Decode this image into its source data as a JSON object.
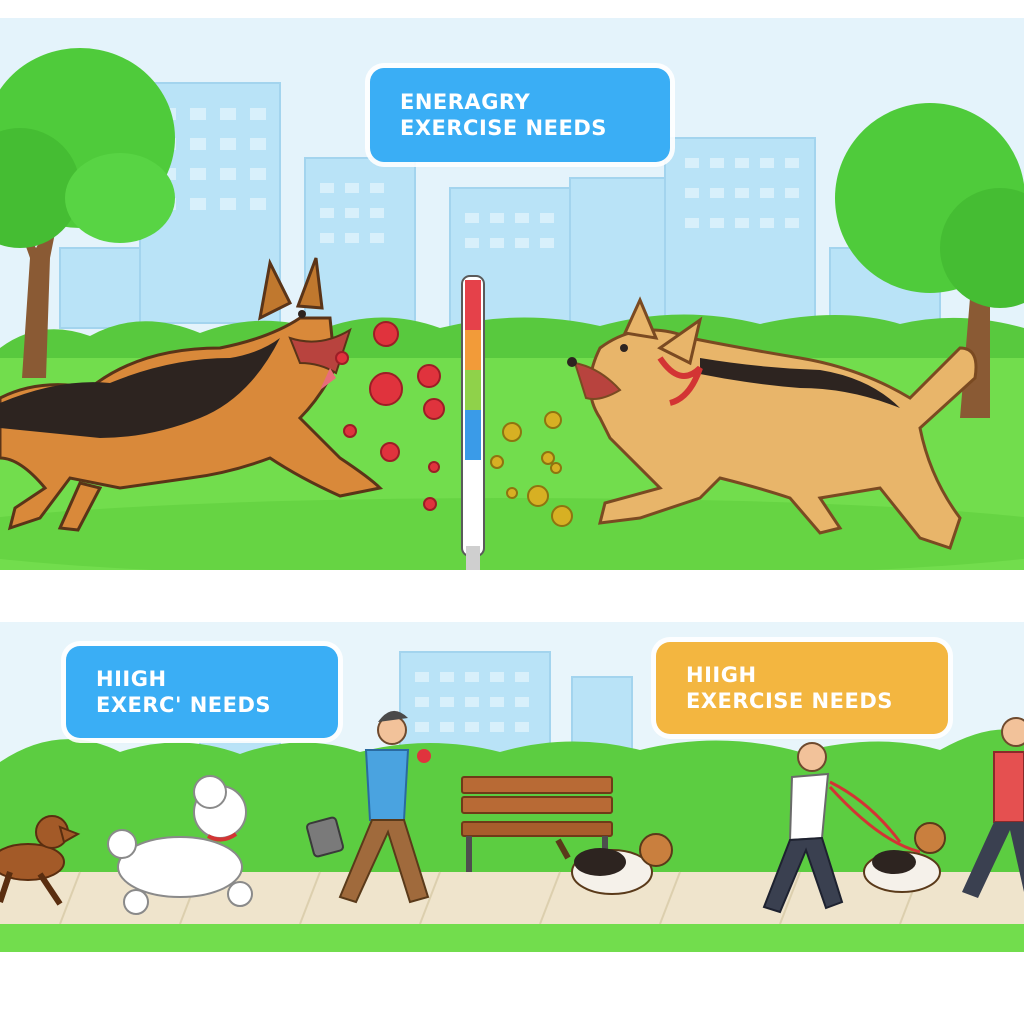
{
  "top_panel": {
    "label_line1": "ENERAGRY",
    "label_line2": "EXERCISE NEEDS",
    "label_color": "#3aaef5"
  },
  "bottom_panel": {
    "left_label_line1": "HIIGH",
    "left_label_line2": "EXERC' NEEDS",
    "left_label_color": "#3aaef5",
    "right_label_line1": "HIIGH",
    "right_label_line2": "EXERCISE NEEDS",
    "right_label_color": "#f3b640"
  },
  "colors": {
    "sky": "#e4f3fb",
    "grass": "#6fdc4a",
    "tree_foliage": "#4fcb3b",
    "building": "#b9e3f7",
    "shepherd_tan": "#d9893a",
    "shepherd_black": "#2d2420",
    "mix_dog_tan": "#e8b56a",
    "red_ball": "#e0333d",
    "yellow_ball": "#d7b023",
    "path": "#efe4cc"
  },
  "icons": [
    "tree-icon",
    "building-icon",
    "dog-icon",
    "ball-icon",
    "meter-icon",
    "bench-icon",
    "person-icon",
    "leash-icon"
  ]
}
